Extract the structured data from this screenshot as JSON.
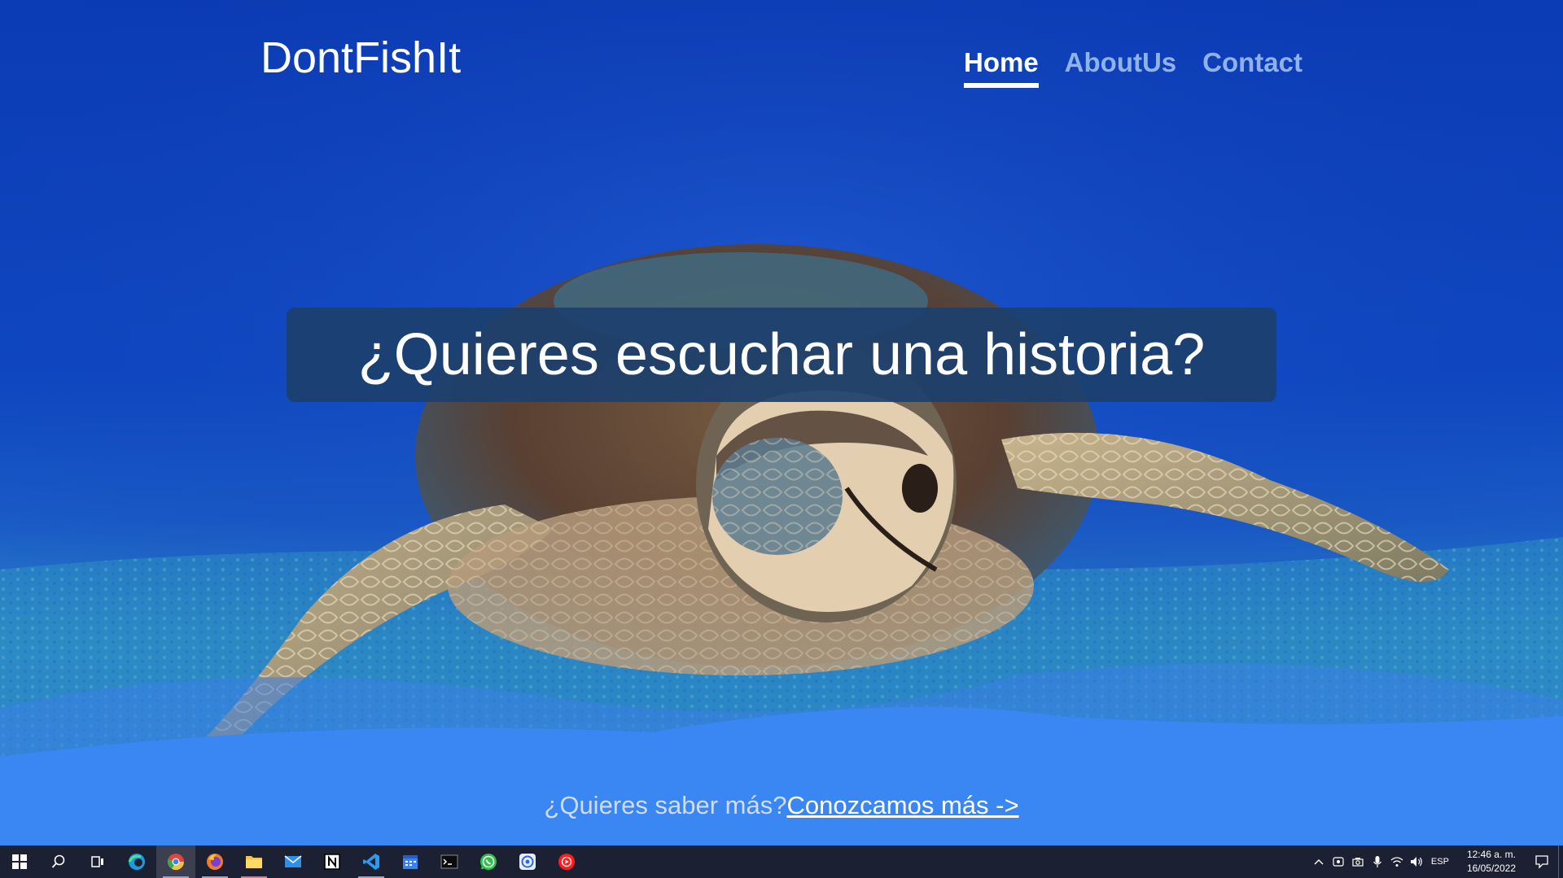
{
  "site": {
    "brand": "DontFishIt",
    "nav": [
      {
        "label": "Home",
        "active": true
      },
      {
        "label": "AboutUs",
        "active": false
      },
      {
        "label": "Contact",
        "active": false
      }
    ]
  },
  "hero": {
    "headline": "¿Quieres escuchar una historia?",
    "cta_question": "¿Quieres saber más?",
    "cta_link": "Conozcamos más ->"
  },
  "taskbar": {
    "apps": [
      {
        "name": "start-icon"
      },
      {
        "name": "search-icon"
      },
      {
        "name": "task-view-icon"
      },
      {
        "name": "edge-icon"
      },
      {
        "name": "chrome-icon"
      },
      {
        "name": "firefox-icon"
      },
      {
        "name": "file-explorer-icon"
      },
      {
        "name": "mail-icon"
      },
      {
        "name": "notion-icon"
      },
      {
        "name": "vscode-icon"
      },
      {
        "name": "calendar-icon"
      },
      {
        "name": "terminal-icon"
      },
      {
        "name": "whatsapp-icon"
      },
      {
        "name": "vpn-icon"
      },
      {
        "name": "youtube-music-icon"
      }
    ],
    "language": "ESP",
    "time": "12:46 a. m.",
    "date": "16/05/2022"
  },
  "colors": {
    "ocean_deep": "#0b3fb8",
    "ocean_mid": "#1f5fc9",
    "wave": "#3a86f2",
    "banner": "#1c406e",
    "nav_inactive": "#8fb2ea"
  }
}
